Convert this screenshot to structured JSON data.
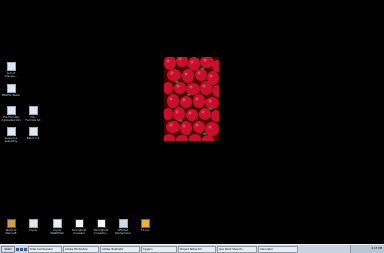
{
  "desktop": {
    "left_icons": [
      {
        "label": "List of\nIrfanvie...",
        "icon": "document-icon"
      },
      {
        "label": "PNGFile Tester",
        "icon": "application-icon"
      },
      {
        "label": "File Formats\n(Uploaded list)",
        "icon": "document-icon"
      },
      {
        "label": "Doc\nFormats.txt",
        "icon": "text-file-icon"
      },
      {
        "label": "Sequence\nassembly",
        "icon": "document-icon"
      },
      {
        "label": "Batch 1.4",
        "icon": "text-file-icon"
      }
    ],
    "bottom_icons": [
      {
        "label": "World of\nWarcraft",
        "icon": "game-icon"
      },
      {
        "label": "Crysis",
        "icon": "game-icon"
      },
      {
        "label": "Crysis\nWARHEAD",
        "icon": "game-icon"
      },
      {
        "label": "Stronghold\nCrusader",
        "icon": "game-icon"
      },
      {
        "label": "Stronghold\nCrusader...",
        "icon": "game-icon"
      },
      {
        "label": "Afflicted\nWarhammer",
        "icon": "game-icon"
      },
      {
        "label": "TX-Ice",
        "icon": "application-icon"
      }
    ],
    "wallpaper": {
      "subject": "strawberries",
      "background": "#000000",
      "accent": "#c8102e"
    }
  },
  "taskbar": {
    "start_label": "Start",
    "tasks": [
      {
        "label": "Total Commander"
      },
      {
        "label": "Adobe Photoshop"
      },
      {
        "label": "Adobe Illustrator"
      },
      {
        "label": "Cygwin"
      },
      {
        "label": "Project Notes.txt"
      },
      {
        "label": "Jasc Paint Shop Pr..."
      },
      {
        "label": "Calculator"
      }
    ],
    "clock": "4:15 PM"
  }
}
